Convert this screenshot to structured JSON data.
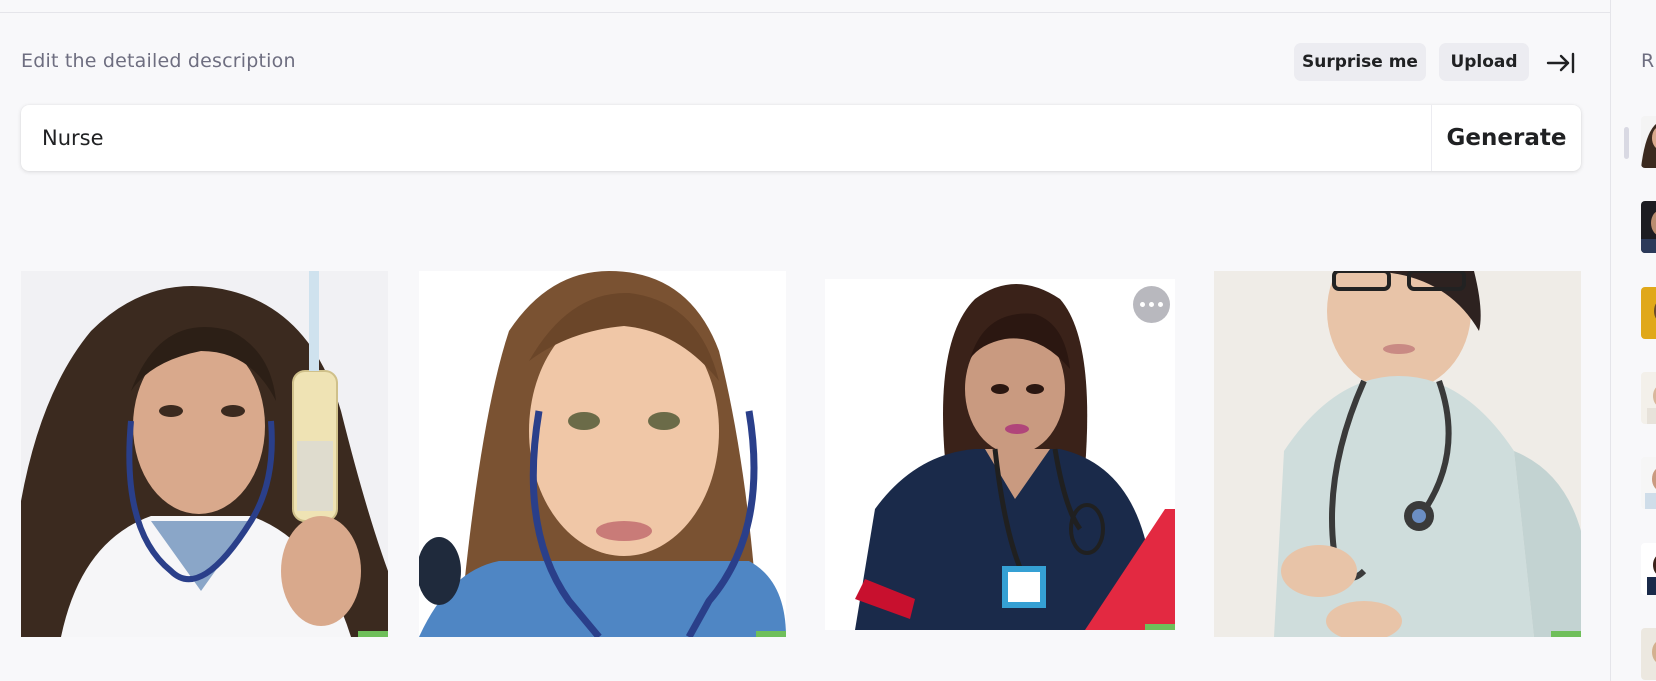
{
  "header": {
    "label": "Edit the detailed description",
    "surprise_label": "Surprise me",
    "upload_label": "Upload"
  },
  "prompt": {
    "value": "Nurse",
    "generate_label": "Generate"
  },
  "results": [
    {
      "name": "nurse-with-syringe"
    },
    {
      "name": "nurse-with-stethoscope-closeup"
    },
    {
      "name": "nurse-navy-scrubs-red-folder"
    },
    {
      "name": "nurse-light-scrubs-glasses"
    }
  ],
  "sidebar": {
    "heading": "R"
  },
  "colors": {
    "background": "#f8f8fa",
    "pill": "#ececf1",
    "text": "#202123",
    "muted": "#6e6e80"
  }
}
